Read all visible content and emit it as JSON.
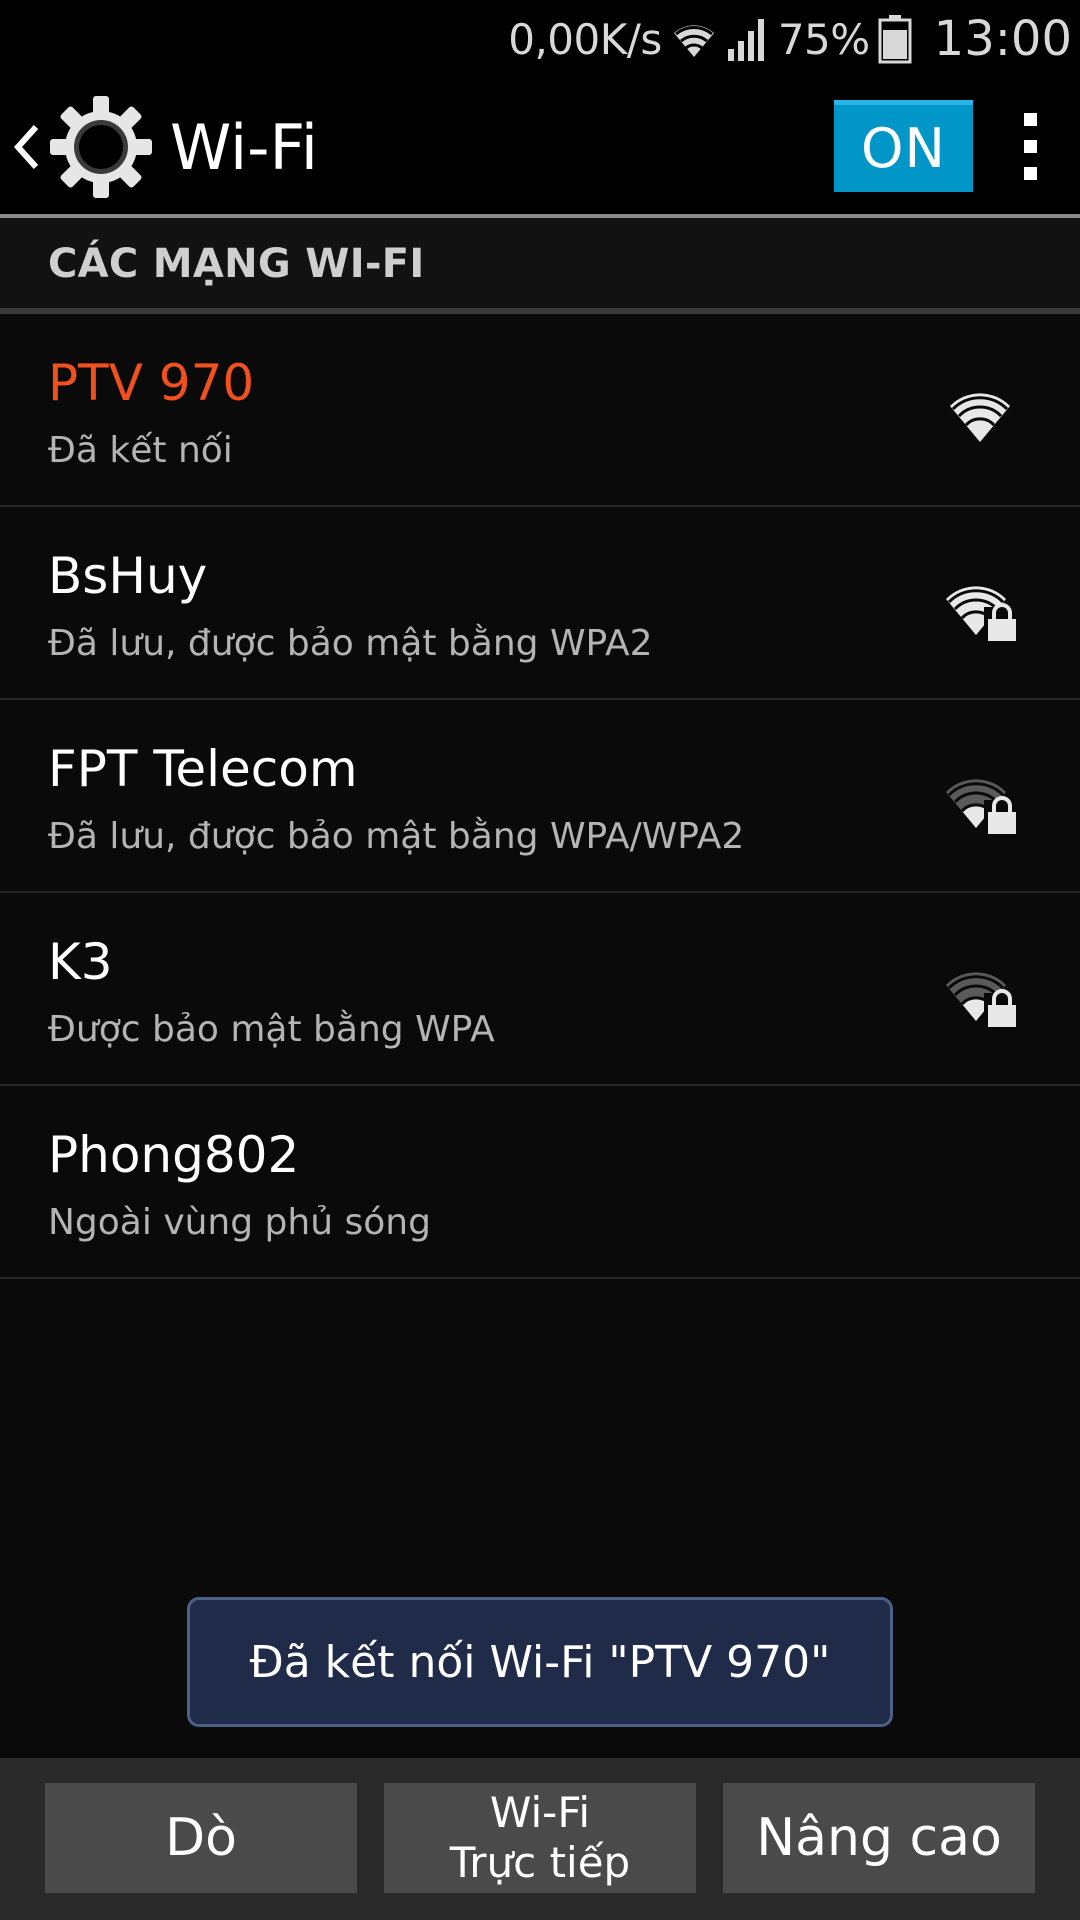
{
  "status_bar": {
    "net_speed": "0,00K/s",
    "battery_percent": "75%",
    "battery_level": 0.75,
    "time": "13:00"
  },
  "action_bar": {
    "title": "Wi-Fi",
    "toggle_label": "ON"
  },
  "section": {
    "title": "CÁC MẠNG WI-FI"
  },
  "networks": [
    {
      "name": "PTV 970",
      "status": "Đã kết nối",
      "connected": true,
      "secured": false,
      "signal_strength": 4
    },
    {
      "name": "BsHuy",
      "status": "Đã lưu, được bảo mật bằng WPA2",
      "connected": false,
      "secured": true,
      "signal_strength": 4
    },
    {
      "name": "FPT Telecom",
      "status": "Đã lưu, được bảo mật bằng WPA/WPA2",
      "connected": false,
      "secured": true,
      "signal_strength": 2
    },
    {
      "name": "K3",
      "status": "Được bảo mật bằng WPA",
      "connected": false,
      "secured": true,
      "signal_strength": 2
    },
    {
      "name": "Phong802",
      "status": "Ngoài vùng phủ sóng",
      "connected": false,
      "secured": false,
      "signal_strength": 0
    }
  ],
  "toast": {
    "message": "Đã kết nối Wi-Fi \"PTV 970\""
  },
  "bottom_bar": {
    "scan_label": "Dò",
    "direct_line1": "Wi-Fi",
    "direct_line2": "Trực tiếp",
    "advanced_label": "Nâng cao"
  },
  "colors": {
    "accent": "#0096c7",
    "connected_text": "#f0511e",
    "toast_bg": "#1f2b49"
  },
  "icons": {
    "status": [
      "wifi-icon",
      "cell-signal-icon",
      "battery-icon"
    ],
    "action": [
      "back-chevron-icon",
      "settings-gear-icon",
      "overflow-menu-icon"
    ],
    "list": [
      "wifi-signal-icon",
      "wifi-locked-icon"
    ]
  }
}
